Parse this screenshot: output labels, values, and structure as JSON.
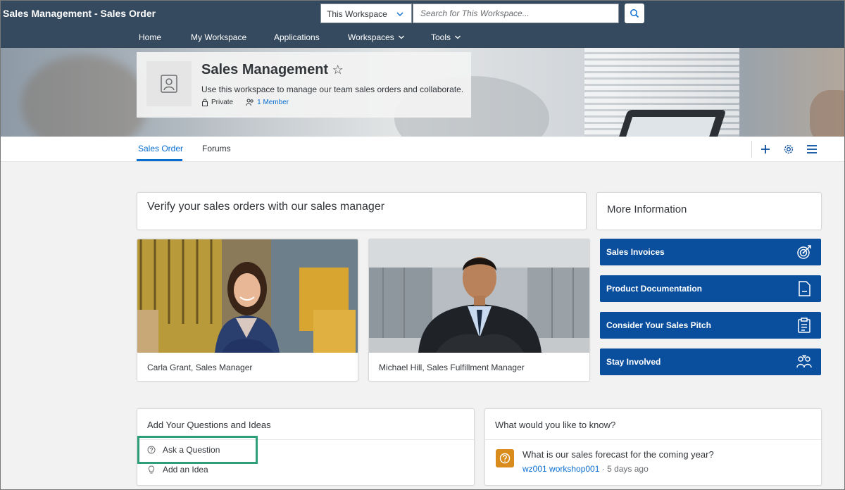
{
  "header": {
    "app_title": "Sales Management - Sales Order",
    "scope_label": "This Workspace",
    "search_placeholder": "Search for This Workspace...",
    "nav": [
      {
        "label": "Home"
      },
      {
        "label": "My Workspace"
      },
      {
        "label": "Applications"
      },
      {
        "label": "Workspaces"
      },
      {
        "label": "Tools"
      }
    ]
  },
  "workspace": {
    "name": "Sales Management",
    "description": "Use this workspace to manage our team sales orders and collaborate.",
    "privacy": "Private",
    "members": "1 Member"
  },
  "tabs": [
    {
      "label": "Sales Order",
      "active": true
    },
    {
      "label": "Forums",
      "active": false
    }
  ],
  "verify_card": {
    "title": "Verify your sales orders with our sales manager"
  },
  "people": [
    {
      "caption": "Carla Grant, Sales Manager"
    },
    {
      "caption": "Michael Hill, Sales Fulfillment Manager"
    }
  ],
  "more_info": {
    "title": "More Information",
    "links": [
      {
        "label": "Sales Invoices",
        "icon": "target-icon"
      },
      {
        "label": "Product Documentation",
        "icon": "document-icon"
      },
      {
        "label": "Consider Your Sales Pitch",
        "icon": "clipboard-icon"
      },
      {
        "label": "Stay Involved",
        "icon": "people-icon"
      }
    ]
  },
  "questions_ideas": {
    "title": "Add Your Questions and Ideas",
    "items": [
      {
        "label": "Ask a Question",
        "icon": "question-icon"
      },
      {
        "label": "Add an Idea",
        "icon": "lightbulb-icon"
      }
    ]
  },
  "what_to_know": {
    "title": "What would you like to know?",
    "question": "What is our sales forecast for the coming year?",
    "author": "wz001 workshop001",
    "time": " · 5 days ago"
  },
  "colors": {
    "shell": "#354a5f",
    "accent": "#0a6ed1",
    "tile": "#0a4f9e",
    "question_badge": "#d98b1c",
    "highlight": "#2e9e7a"
  }
}
